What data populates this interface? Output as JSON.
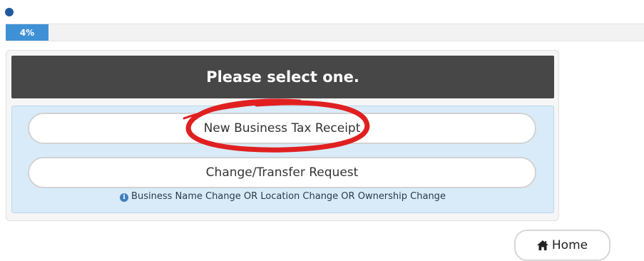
{
  "progress": {
    "label": "4%",
    "fraction": 0.04
  },
  "panel": {
    "heading": "Please select one."
  },
  "options": [
    {
      "label": "New Business Tax Receipt"
    },
    {
      "label": "Change/Transfer Request"
    }
  ],
  "info": {
    "icon": "info-circle-icon",
    "text": "Business Name Change OR Location Change OR Ownership Change"
  },
  "nav": {
    "home_label": "Home",
    "home_icon": "home-icon"
  },
  "colors": {
    "accent": "#3f91d6",
    "header_bg": "#474747",
    "options_bg": "#d9ebf8",
    "annotation": "#e02020"
  }
}
